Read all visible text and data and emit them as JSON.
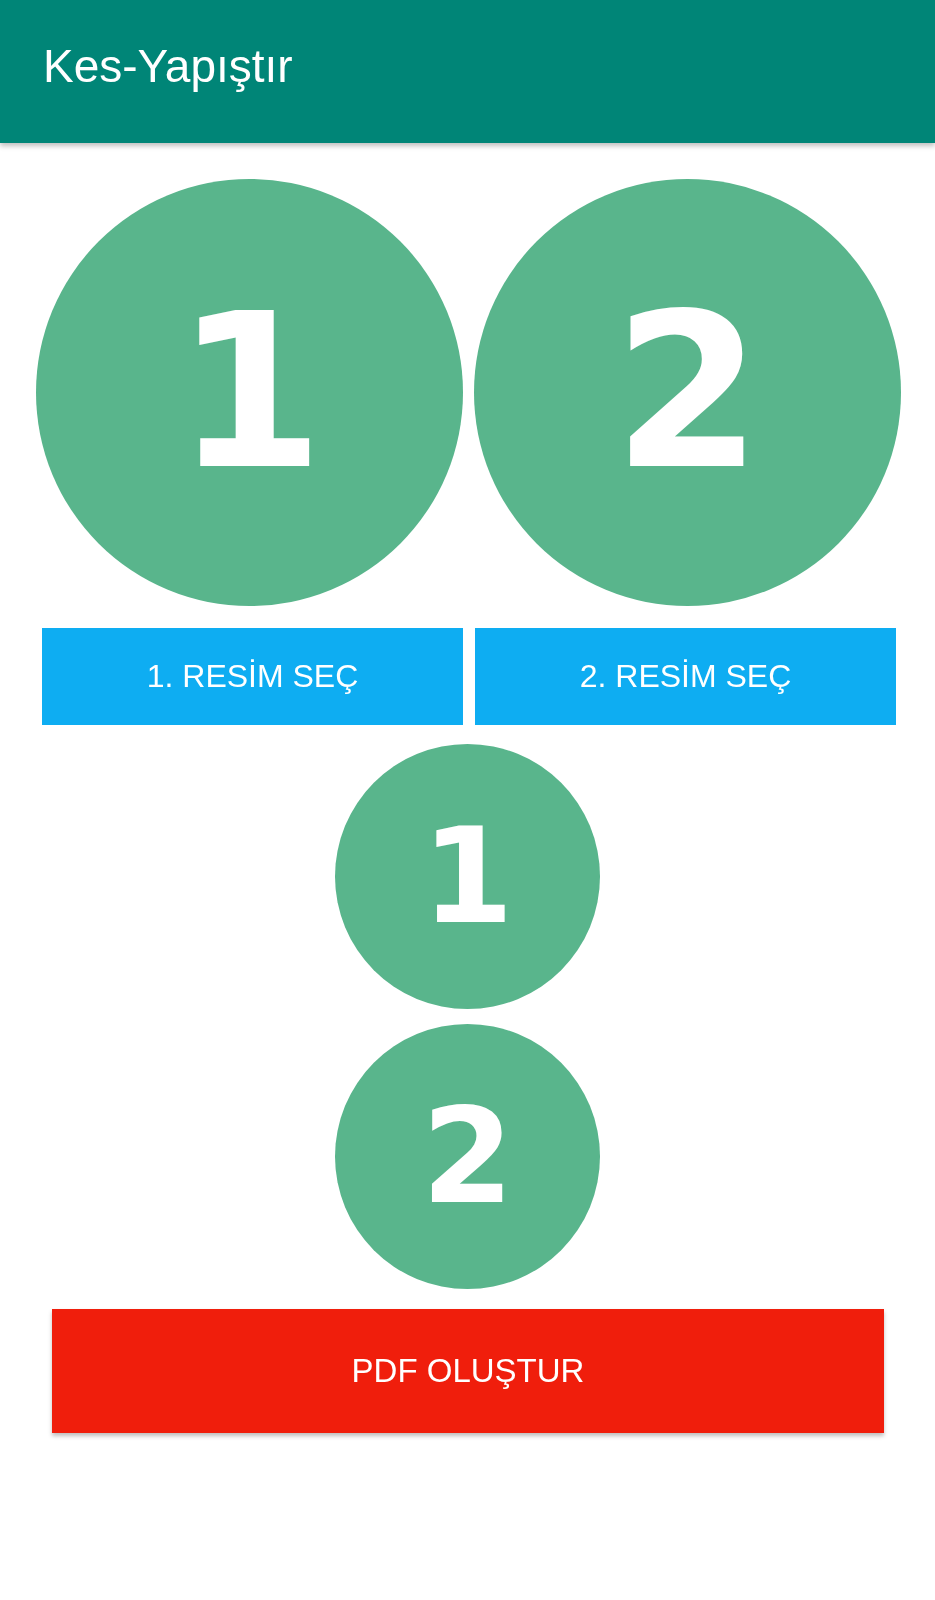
{
  "app_bar": {
    "title": "Kes-Yapıştır"
  },
  "image_slots": [
    {
      "label": "1"
    },
    {
      "label": "2"
    }
  ],
  "pick_buttons": [
    "1. RESİM SEÇ",
    "2. RESİM SEÇ"
  ],
  "previews": [
    {
      "label": "1"
    },
    {
      "label": "2"
    }
  ],
  "create_button": "PDF OLUŞTUR"
}
